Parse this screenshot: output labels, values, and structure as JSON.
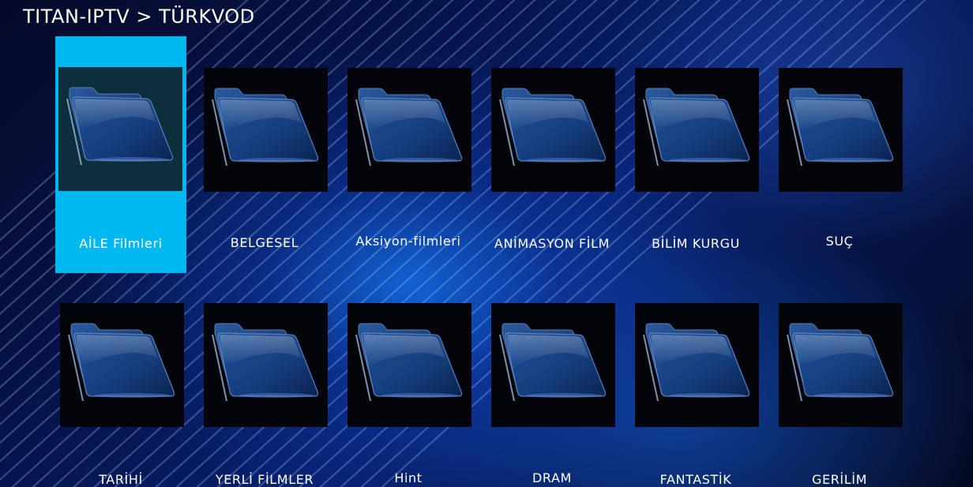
{
  "header": {
    "title": "TITAN-IPTV > TÜRKVOD"
  },
  "colors": {
    "selection": "#00b8f0",
    "folder": "#1a4a8c"
  },
  "folder_icon": "folder-icon",
  "categories": [
    {
      "label": "AİLE Filmleri",
      "selected": true
    },
    {
      "label": "BELGESEL"
    },
    {
      "label": "Aksiyon-filmleri"
    },
    {
      "label": "ANİMASYON FİLM"
    },
    {
      "label": "BİLİM KURGU"
    },
    {
      "label": "SUÇ"
    },
    {
      "label": "TARİHİ"
    },
    {
      "label": "YERLİ FİLMLER"
    },
    {
      "label": "Hint"
    },
    {
      "label": "DRAM"
    },
    {
      "label": "FANTASTİK"
    },
    {
      "label": "GERİLİM"
    }
  ]
}
